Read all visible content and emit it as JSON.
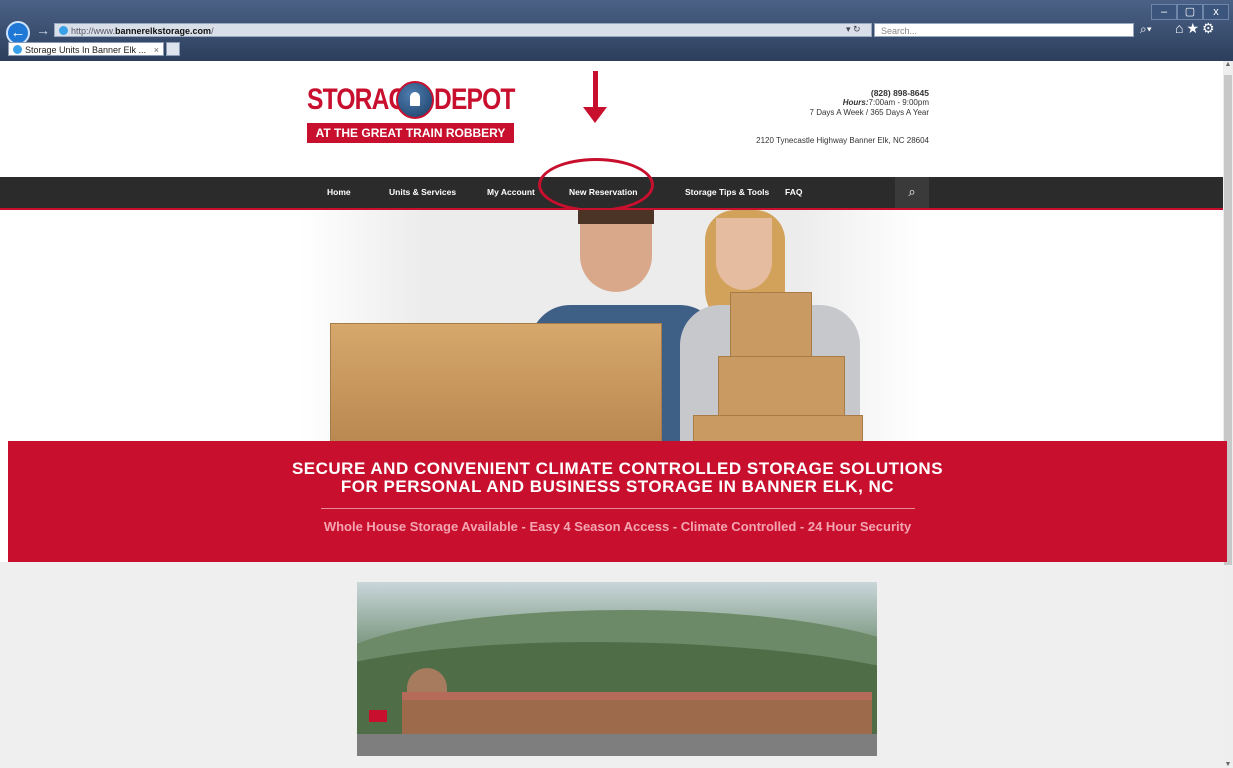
{
  "browser": {
    "url_prefix": "http://www.",
    "url_domain": "bannerelkstorage.com",
    "url_suffix": "/",
    "search_placeholder": "Search...",
    "tab_title": "Storage Units In Banner Elk ...",
    "window_controls": [
      "–",
      "▢",
      "x"
    ]
  },
  "logo": {
    "word_left": "STORAGE",
    "word_right": "DEPOT",
    "tagline": "AT THE GREAT TRAIN ROBBERY"
  },
  "contact": {
    "phone": "(828) 898-8645",
    "hours_label": "Hours:",
    "hours": "7:00am - 9:00pm",
    "days": "7 Days A Week / 365 Days A Year",
    "address": "2120 Tynecastle Highway Banner Elk, NC 28604"
  },
  "nav": {
    "items": [
      "Home",
      "Units & Services",
      "My Account",
      "New Reservation",
      "Storage Tips & Tools",
      "FAQ"
    ]
  },
  "banner": {
    "headline_line1": "SECURE AND CONVENIENT CLIMATE CONTROLLED STORAGE SOLUTIONS",
    "headline_line2": "FOR PERSONAL AND BUSINESS STORAGE IN BANNER ELK, NC",
    "subline": "Whole House Storage Available - Easy 4 Season Access - Climate Controlled - 24 Hour Security"
  },
  "colors": {
    "brand_red": "#c8102e",
    "nav_bg": "#2b2b2b",
    "page_bg": "#efefef"
  },
  "icons": [
    "back-arrow-icon",
    "forward-arrow-icon",
    "refresh-icon",
    "search-icon",
    "home-icon",
    "favorites-star-icon",
    "settings-gear-icon",
    "padlock-logo-icon",
    "annotation-arrow-icon"
  ]
}
